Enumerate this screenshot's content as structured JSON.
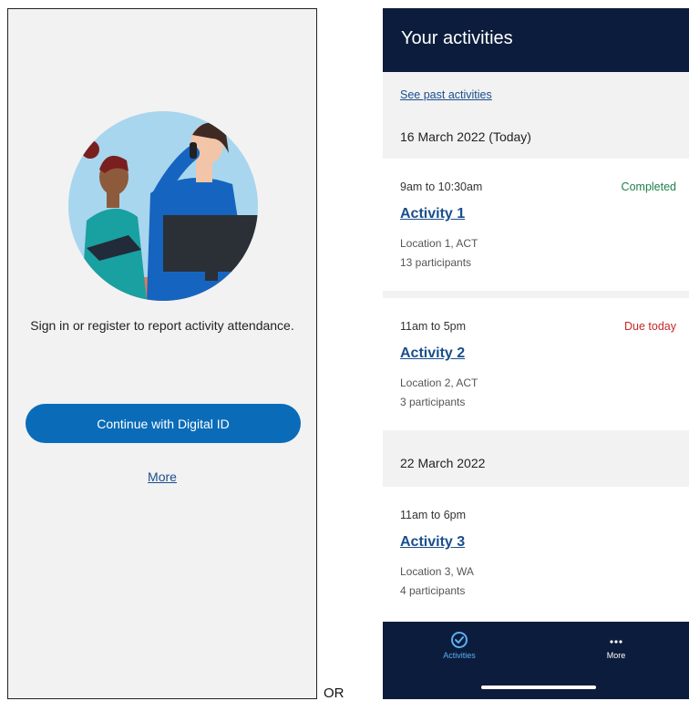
{
  "left_screen": {
    "message": "Sign in or register to report activity attendance.",
    "primary_button": "Continue with Digital ID",
    "more_link": "More"
  },
  "separator": "OR",
  "right_screen": {
    "header_title": "Your activities",
    "past_link": "See past activities",
    "groups": [
      {
        "date": "16 March 2022 (Today)",
        "activities": [
          {
            "time": "9am to 10:30am",
            "status": "Completed",
            "status_color": "#1e7f4a",
            "name": "Activity 1",
            "location": "Location 1, ACT",
            "participants": "13 participants"
          },
          {
            "time": "11am to 5pm",
            "status": "Due today",
            "status_color": "#c62828",
            "name": "Activity 2",
            "location": "Location 2, ACT",
            "participants": "3 participants"
          }
        ]
      },
      {
        "date": "22 March 2022",
        "activities": [
          {
            "time": "11am to 6pm",
            "status": "",
            "status_color": "",
            "name": "Activity 3",
            "location": "Location 3, WA",
            "participants": "4 participants"
          }
        ]
      }
    ],
    "tabs": [
      {
        "label": "Activities",
        "icon": "check-circle-icon",
        "active": true,
        "color": "#5ab0f0"
      },
      {
        "label": "More",
        "icon": "ellipsis-icon",
        "active": false,
        "color": "#ffffff"
      }
    ]
  },
  "colors": {
    "header_bg": "#0c1c3c",
    "primary_button": "#0a6cb8",
    "link": "#1a4e8c"
  }
}
